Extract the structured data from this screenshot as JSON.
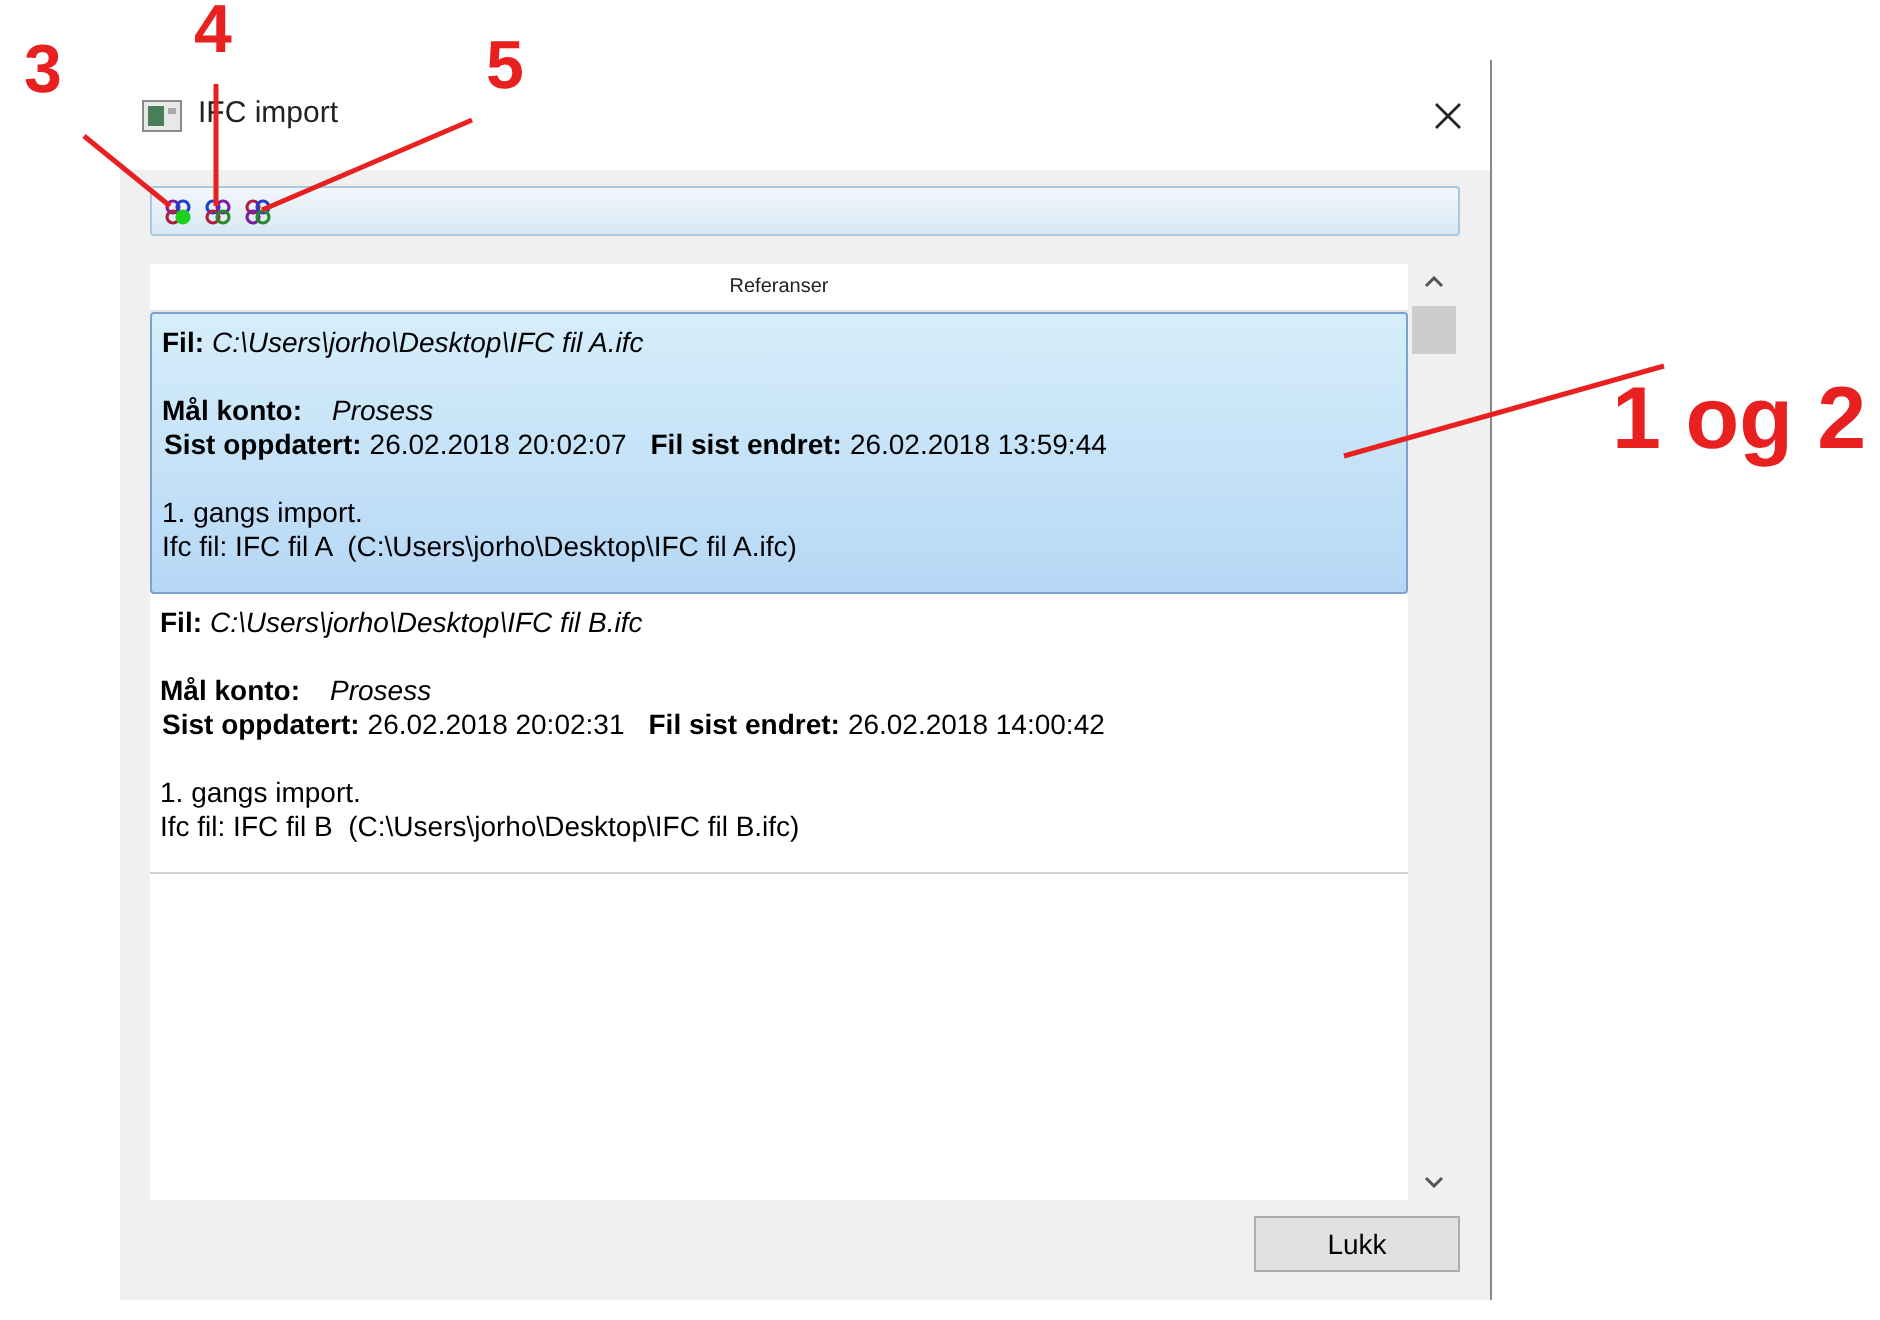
{
  "window": {
    "title": "IFC import"
  },
  "list": {
    "header": "Referanser",
    "items": [
      {
        "selected": true,
        "file_label": "Fil:",
        "file_path": "C:\\Users\\jorho\\Desktop\\IFC fil A.ifc",
        "account_label": "Mål konto:",
        "account": "Prosess",
        "updated_label": "Sist oppdatert:",
        "updated": "26.02.2018 20:02:07",
        "changed_label": "Fil sist endret:",
        "changed": "26.02.2018 13:59:44",
        "note": "1. gangs import.",
        "ifc_line": "Ifc fil: IFC fil A  (C:\\Users\\jorho\\Desktop\\IFC fil A.ifc)"
      },
      {
        "selected": false,
        "file_label": "Fil:",
        "file_path": "C:\\Users\\jorho\\Desktop\\IFC fil B.ifc",
        "account_label": "Mål konto:",
        "account": "Prosess",
        "updated_label": "Sist oppdatert:",
        "updated": "26.02.2018 20:02:31",
        "changed_label": "Fil sist endret:",
        "changed": "26.02.2018 14:00:42",
        "note": "1. gangs import.",
        "ifc_line": "Ifc fil: IFC fil B  (C:\\Users\\jorho\\Desktop\\IFC fil B.ifc)"
      }
    ]
  },
  "buttons": [
    "Lukk"
  ],
  "annotations": [
    {
      "label": "3"
    },
    {
      "label": "4"
    },
    {
      "label": "5"
    },
    {
      "label": "1 og 2"
    }
  ]
}
